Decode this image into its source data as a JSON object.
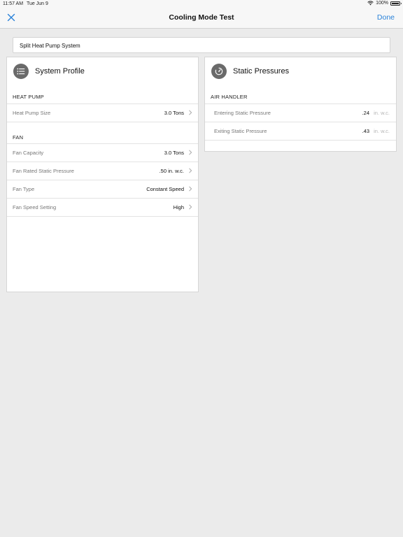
{
  "status": {
    "time": "11:57 AM",
    "date": "Tue Jun 9",
    "battery": "100%"
  },
  "nav": {
    "title": "Cooling Mode Test",
    "done_label": "Done"
  },
  "system_type": "Split Heat Pump System",
  "profile": {
    "title": "System Profile",
    "sections": [
      {
        "label": "HEAT PUMP",
        "rows": [
          {
            "label": "Heat Pump Size",
            "value": "3.0 Tons"
          }
        ]
      },
      {
        "label": "FAN",
        "rows": [
          {
            "label": "Fan Capacity",
            "value": "3.0 Tons"
          },
          {
            "label": "Fan Rated Static Pressure",
            "value": ".50 in. w.c."
          },
          {
            "label": "Fan Type",
            "value": "Constant Speed"
          },
          {
            "label": "Fan Speed Setting",
            "value": "High"
          }
        ]
      }
    ]
  },
  "pressures": {
    "title": "Static Pressures",
    "section_label": "AIR HANDLER",
    "rows": [
      {
        "label": "Entering Static Pressure",
        "value": ".24",
        "unit": "in. w.c."
      },
      {
        "label": "Exiting Static Pressure",
        "value": ".43",
        "unit": "in. w.c."
      }
    ]
  },
  "colors": {
    "accent": "#2a82d9",
    "icon_bg": "#6a6a6a",
    "background": "#ebebeb"
  }
}
